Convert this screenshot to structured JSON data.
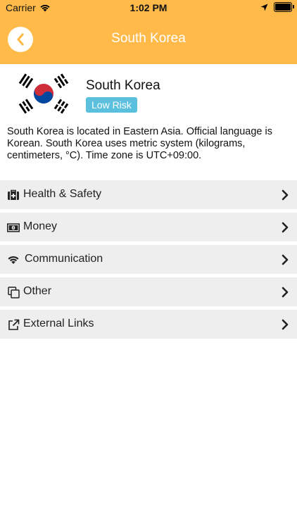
{
  "status_bar": {
    "carrier": "Carrier",
    "time": "1:02 PM"
  },
  "nav": {
    "title": "South Korea"
  },
  "country": {
    "name": "South Korea",
    "risk_label": "Low Risk",
    "description": "South Korea is located in Eastern Asia. Official language is Korean. South Korea uses metric system (kilograms, centimeters, °C). Time zone is UTC+09:00."
  },
  "menu": {
    "items": [
      {
        "label": "Health & Safety",
        "icon": "first-aid-kit-icon"
      },
      {
        "label": "Money",
        "icon": "banknote-icon"
      },
      {
        "label": "Communication",
        "icon": "wifi-icon"
      },
      {
        "label": "Other",
        "icon": "copy-icon"
      },
      {
        "label": "External Links",
        "icon": "external-link-icon"
      }
    ]
  },
  "colors": {
    "accent": "#FFBA49",
    "badge": "#5BC0DE",
    "menu_bg": "#EEEEEE",
    "flag_red": "#CD2E3A",
    "flag_blue": "#0047A0"
  }
}
